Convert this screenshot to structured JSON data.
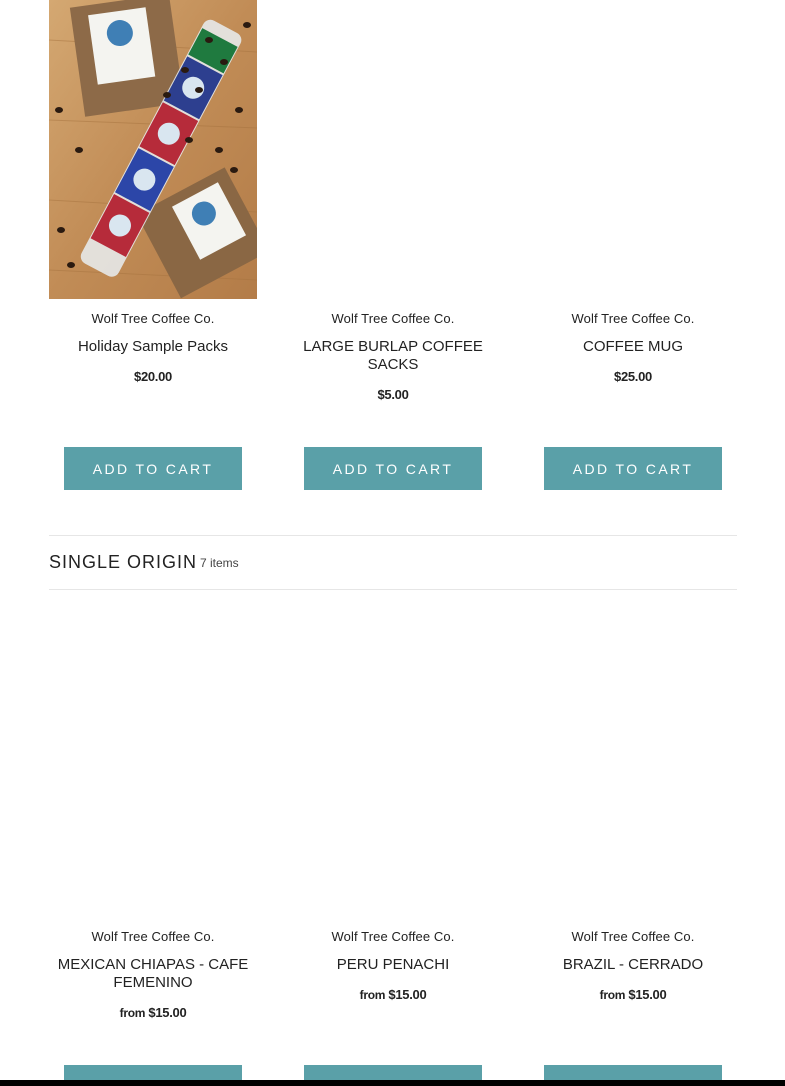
{
  "vendor": "Wolf Tree Coffee Co.",
  "add_to_cart_label": "ADD TO CART",
  "accent_color": "#5aa0a8",
  "row1": [
    {
      "title": "Holiday Sample Packs",
      "price": "$20.00",
      "image": "holiday-sample-packs-photo"
    },
    {
      "title": "LARGE BURLAP COFFEE SACKS",
      "price": "$5.00"
    },
    {
      "title": "COFFEE MUG",
      "price": "$25.00"
    }
  ],
  "section": {
    "title": "SINGLE ORIGIN",
    "count": "7 items"
  },
  "row2": [
    {
      "title": "MEXICAN CHIAPAS - CAFE FEMENINO",
      "price_prefix": "from",
      "price": "$15.00"
    },
    {
      "title": "PERU PENACHI",
      "price_prefix": "from",
      "price": "$15.00"
    },
    {
      "title": "BRAZIL - CERRADO",
      "price_prefix": "from",
      "price": "$15.00"
    }
  ]
}
